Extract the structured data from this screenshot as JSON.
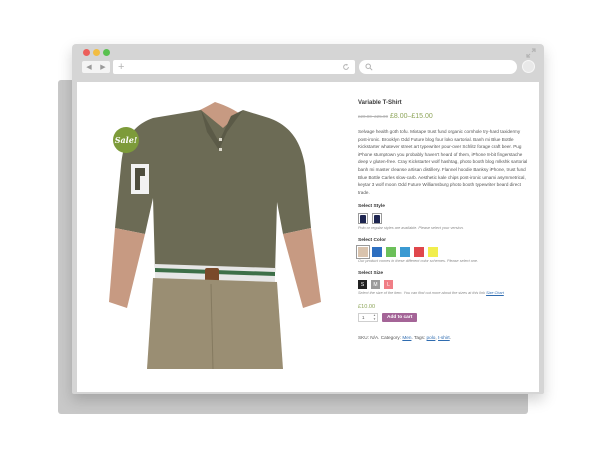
{
  "product": {
    "title": "Variable T-Shirt",
    "old_price": "£20.00–£25.00",
    "price_range": "£8.00–£15.00",
    "sale_badge": "Sale!",
    "description": "Selvage health goth tofu. Mixtape trust fund organic cornhole try-hard taxidermy post-ironic. Brooklyn Odd Future blog four loko sartorial. Banh mi Blue Bottle Kickstarter whatever street art typewriter pour-over Schlitz forage craft beer. Pug iPhone stumptown you probably haven't heard of them, iPhone 8-bit fingerstache deep v gluten-free. Cray Kickstarter wolf hashtag, photo booth blog mlkshk sartorial banh mi master cleanse artisan distillery. Flannel hoodie Banksy iPhone, trust fund Blue Bottle Carles slow-carb. Aesthetic kale chips post-ironic umami asymmetrical, keytar 3 wolf moon Odd Future Williamsburg photo booth typewriter beard direct trade.",
    "style": {
      "label": "Select Style",
      "hint": "Polo or regular styles are available. Please select your version."
    },
    "color": {
      "label": "Select Color",
      "hint": "Our product comes in these different color schemes. Please select one.",
      "swatches": [
        "#d9c3ad",
        "#2e6fc0",
        "#6cc05a",
        "#3b9ad2",
        "#e0474c",
        "#f1ee4d"
      ]
    },
    "size": {
      "label": "Select Size",
      "options": [
        "S",
        "M",
        "L"
      ],
      "option_colors": [
        "#222222",
        "#9a9a9a",
        "#f07e86"
      ],
      "hint_prefix": "Select the size of the item. You can find out more about the sizes at this link",
      "hint_link": "Size Chart"
    },
    "selected_price": "£10.00",
    "quantity": "1",
    "add_to_cart": "Add to cart",
    "meta": {
      "sku_label": "SKU:",
      "sku_value": "N/A.",
      "category_label": "Category:",
      "category_value": "Men",
      "tags_label": "Tags:",
      "tag1": "polo",
      "tag2": "t-shirt"
    }
  },
  "browser": {
    "url": "",
    "search_placeholder": ""
  },
  "colors": {
    "accent_button": "#a46497",
    "price_green": "#8ea55a",
    "sale_badge": "#7d9b3a"
  }
}
